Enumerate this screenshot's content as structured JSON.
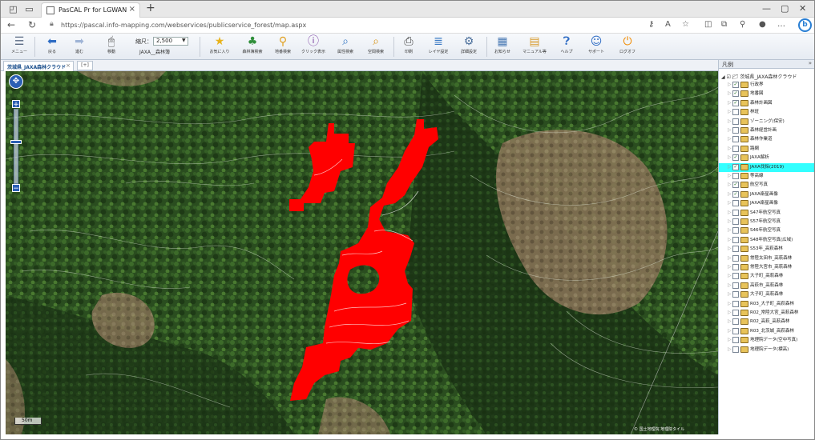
{
  "browser": {
    "tab_title": "PasCAL Pr for LGWAN",
    "url": "https://pascal.info-mapping.com/webservices/publicservice_forest/map.aspx"
  },
  "toolbar": {
    "buttons": [
      {
        "label": "メニュー",
        "icon": "menu-icon"
      },
      {
        "label": "戻る",
        "icon": "back-icon"
      },
      {
        "label": "進む",
        "icon": "forward-icon"
      },
      {
        "label": "移動",
        "icon": "mouse-icon"
      },
      {
        "label": "お気に入り",
        "icon": "star-icon"
      },
      {
        "label": "森林簿検索",
        "icon": "tree-icon"
      },
      {
        "label": "地番検索",
        "icon": "search-icon"
      },
      {
        "label": "クリック表示",
        "icon": "info-icon"
      },
      {
        "label": "属性検索",
        "icon": "attr-search-icon"
      },
      {
        "label": "空間検索",
        "icon": "spatial-search-icon"
      },
      {
        "label": "印刷",
        "icon": "print-icon"
      },
      {
        "label": "レイヤ設定",
        "icon": "layer-icon"
      },
      {
        "label": "詳細設定",
        "icon": "settings-icon"
      },
      {
        "label": "お知らせ",
        "icon": "notice-icon"
      },
      {
        "label": "マニュアル等",
        "icon": "manual-icon"
      },
      {
        "label": "ヘルプ",
        "icon": "help-icon"
      },
      {
        "label": "サポート",
        "icon": "support-icon"
      },
      {
        "label": "ログオフ",
        "icon": "power-icon"
      }
    ],
    "scale_label": "縮尺：",
    "scale_value": "2,500",
    "scale_sub": "JAXA__森林簿"
  },
  "map_tabs": {
    "active": "茨城県_JAXA森林クラウド",
    "add": "[+]"
  },
  "map": {
    "scalebar": "50m",
    "copyright": "© 国土地理院 地理院タイル",
    "highlight_color": "#ff0000"
  },
  "legend": {
    "title": "凡例",
    "root": "茨城県_JAXA森林クラウド",
    "layers": [
      {
        "label": "行政界",
        "checked": true
      },
      {
        "label": "地番図",
        "checked": true
      },
      {
        "label": "森林計画図",
        "checked": true
      },
      {
        "label": "林班",
        "checked": false
      },
      {
        "label": "ゾーニング(保安)",
        "checked": false
      },
      {
        "label": "森林経営計画",
        "checked": false
      },
      {
        "label": "森林作業道",
        "checked": false
      },
      {
        "label": "路網",
        "checked": false
      },
      {
        "label": "JAXA解析",
        "checked": true
      },
      {
        "label": "JAXA伐採(2019)",
        "checked": true,
        "highlight": true
      },
      {
        "label": "等高線",
        "checked": false
      },
      {
        "label": "航空写真",
        "checked": true
      },
      {
        "label": "JAXA衛星画像",
        "checked": true
      },
      {
        "label": "JAXA衛星画像",
        "checked": false
      },
      {
        "label": "S47年航空写真",
        "checked": false
      },
      {
        "label": "S57年航空写真",
        "checked": false
      },
      {
        "label": "S46年航空写真",
        "checked": false
      },
      {
        "label": "S48年航空写真(広域)",
        "checked": false
      },
      {
        "label": "S53年_高萩森林",
        "checked": false
      },
      {
        "label": "常陸太田市_高萩森林",
        "checked": false
      },
      {
        "label": "常陸大宮市_高萩森林",
        "checked": false
      },
      {
        "label": "大子町_高萩森林",
        "checked": false
      },
      {
        "label": "高萩市_高萩森林",
        "checked": false
      },
      {
        "label": "大子町_高萩森林",
        "checked": false
      },
      {
        "label": "R03_大子町_高萩森林",
        "checked": false
      },
      {
        "label": "R02_常陸大宮_高萩森林",
        "checked": false
      },
      {
        "label": "R02_高萩_高萩森林",
        "checked": false
      },
      {
        "label": "R03_北茨城_高萩森林",
        "checked": false
      },
      {
        "label": "地理院データ(空中写真)",
        "checked": false
      },
      {
        "label": "地理院データ(標高)",
        "checked": false
      }
    ]
  }
}
